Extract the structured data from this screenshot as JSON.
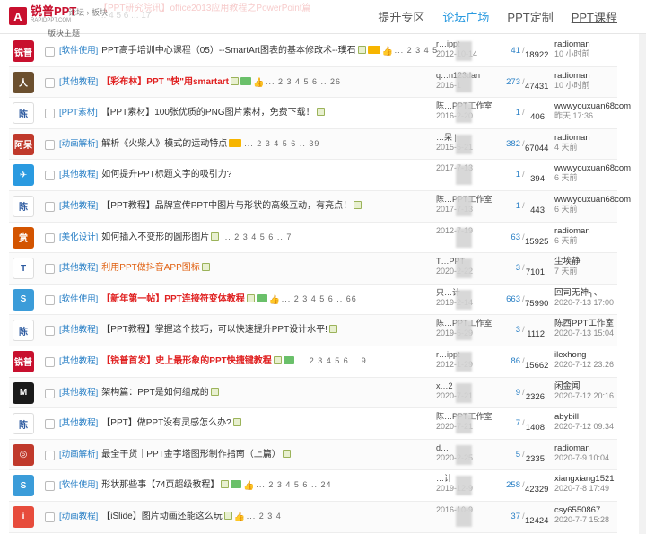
{
  "header": {
    "logo_mark": "A",
    "logo_text": "锐普PPT",
    "logo_sub": "RAPIDPPT.COM",
    "breadcrumb": "论坛 › 板块",
    "ghost_line1": "【PPT研究院讯】office2013应用教程之PowerPoint篇",
    "ghost_line2": "... 4 5 6 ... 17",
    "subtitle": "版块主题",
    "nav": [
      "提升专区",
      "论坛广场",
      "PPT定制",
      "PPT课程"
    ]
  },
  "threads": [
    {
      "cat": "[软件使用]",
      "title": "PPT高手培训中心课程（05）--SmartArt图表的基本修改术--璞石",
      "style": "",
      "pages": "2 3 4 5",
      "icons": [
        "img",
        "hot",
        "thumb"
      ],
      "author": "r…ippt",
      "date": "2012-10-14",
      "replies": "41",
      "views": "18922",
      "last_user": "radioman",
      "last_time": "10 小时前",
      "avatar_color": "#c8102e",
      "avatar_text": "锐普"
    },
    {
      "cat": "[其他教程]",
      "title": "【彩布林】PPT \"快\"用smartart",
      "style": "red",
      "pages": "2 3 4 5 6 .. 26",
      "icons": [
        "img",
        "new",
        "thumb"
      ],
      "author": "q…n123dan",
      "date": "2016-1",
      "replies": "273",
      "views": "47431",
      "last_user": "radioman",
      "last_time": "10 小时前",
      "avatar_color": "#6b4f2e",
      "avatar_text": "人"
    },
    {
      "cat": "[PPT素材]",
      "title": "【PPT素材】100张优质的PNG图片素材，免费下载！",
      "style": "",
      "pages": "",
      "icons": [
        "img"
      ],
      "author": "陈…PPT工作室",
      "date": "2016-2-20",
      "replies": "1",
      "views": "406",
      "last_user": "wwwyouxuan68com",
      "last_time": "昨天 17:36",
      "avatar_color": "#ffffff",
      "avatar_text": "陈"
    },
    {
      "cat": "[动画解析]",
      "title": "解析《火柴人》模式的运动特点",
      "style": "",
      "pages": "2 3 4 5 6 .. 39",
      "icons": [
        "hot"
      ],
      "author": "…呆 |",
      "date": "2015-5-21",
      "replies": "382",
      "views": "67044",
      "last_user": "radioman",
      "last_time": "4 天前",
      "avatar_color": "#c0392b",
      "avatar_text": "阿呆"
    },
    {
      "cat": "[其他教程]",
      "title": "如何提升PPT标题文字的吸引力?",
      "style": "",
      "pages": "",
      "icons": [],
      "author": "",
      "date": "2017-7-13",
      "replies": "1",
      "views": "394",
      "last_user": "wwwyouxuan68com",
      "last_time": "6 天前",
      "avatar_color": "#2a9ae0",
      "avatar_text": "✈"
    },
    {
      "cat": "[其他教程]",
      "title": "【PPT教程】品牌宣传PPT中图片与形状的高级互动，有亮点！",
      "style": "",
      "pages": "",
      "icons": [
        "img"
      ],
      "author": "陈…PPT工作室",
      "date": "2017-7-13",
      "replies": "1",
      "views": "443",
      "last_user": "wwwyouxuan68com",
      "last_time": "6 天前",
      "avatar_color": "#ffffff",
      "avatar_text": "陈"
    },
    {
      "cat": "[美化设计]",
      "title": "如何插入不变形的圆形图片",
      "style": "",
      "pages": "2 3 4 5 6 .. 7",
      "icons": [
        "img"
      ],
      "author": "",
      "date": "2012-7-19",
      "replies": "63",
      "views": "15925",
      "last_user": "radioman",
      "last_time": "6 天前",
      "avatar_color": "#d35400",
      "avatar_text": "赏"
    },
    {
      "cat": "[其他教程]",
      "title": "利用PPT做抖音APP图标",
      "style": "orange",
      "pages": "",
      "icons": [
        "img"
      ],
      "author": "T…PPT",
      "date": "2020-2-22",
      "replies": "3",
      "views": "7101",
      "last_user": "尘埃静",
      "last_time": "7 天前",
      "avatar_color": "#ffffff",
      "avatar_text": "T"
    },
    {
      "cat": "[软件使用]",
      "title": "【新年第一帖】PPT连接符变体教程",
      "style": "red",
      "pages": "2 3 4 5 6 .. 66",
      "icons": [
        "img",
        "new",
        "thumb"
      ],
      "author": "只…计",
      "date": "2019-2-14",
      "replies": "663",
      "views": "75990",
      "last_user": "回司无神╮、",
      "last_time": "2020-7-13 17:00",
      "avatar_color": "#3b9cd9",
      "avatar_text": "S"
    },
    {
      "cat": "[其他教程]",
      "title": "【PPT教程】掌握这个技巧，可以快速提升PPT设计水平!",
      "style": "",
      "pages": "",
      "icons": [
        "img"
      ],
      "author": "陈…PPT工作室",
      "date": "2019-5-29",
      "replies": "3",
      "views": "1112",
      "last_user": "陈西PPT工作室",
      "last_time": "2020-7-13 15:04",
      "avatar_color": "#ffffff",
      "avatar_text": "陈"
    },
    {
      "cat": "[其他教程]",
      "title": "【锐普首发】史上最形象的PPT快捷键教程",
      "style": "red",
      "pages": "2 3 4 5 6 .. 9",
      "icons": [
        "img",
        "new"
      ],
      "author": "r…ippt",
      "date": "2012-1-29",
      "replies": "86",
      "views": "15662",
      "last_user": "ilexhong",
      "last_time": "2020-7-12 23:26",
      "avatar_color": "#c8102e",
      "avatar_text": "锐普"
    },
    {
      "cat": "[其他教程]",
      "title": "架构篇：PPT是如何组成的",
      "style": "",
      "pages": "",
      "icons": [
        "img"
      ],
      "author": "x…2",
      "date": "2020-7-21",
      "replies": "9",
      "views": "2326",
      "last_user": "闲金闻",
      "last_time": "2020-7-12 20:16",
      "avatar_color": "#1a1a1a",
      "avatar_text": "M"
    },
    {
      "cat": "[其他教程]",
      "title": "【PPT】做PPT没有灵感怎么办?",
      "style": "",
      "pages": "",
      "icons": [
        "img"
      ],
      "author": "陈…PPT工作室",
      "date": "2020-7-21",
      "replies": "7",
      "views": "1408",
      "last_user": "abybill",
      "last_time": "2020-7-12 09:34",
      "avatar_color": "#ffffff",
      "avatar_text": "陈"
    },
    {
      "cat": "[动画解析]",
      "title": "最全干货｜PPT金字塔图形制作指南（上篇）",
      "style": "",
      "pages": "",
      "icons": [
        "img"
      ],
      "author": "d…",
      "date": "2020-2-25",
      "replies": "5",
      "views": "2335",
      "last_user": "radioman",
      "last_time": "2020-7-9 10:04",
      "avatar_color": "#c0392b",
      "avatar_text": "◎"
    },
    {
      "cat": "[软件使用]",
      "title": "形状那些事【74页超级教程】",
      "style": "",
      "pages": "2 3 4 5 6 .. 24",
      "icons": [
        "img",
        "new",
        "thumb"
      ],
      "author": "…计",
      "date": "2019-12-9",
      "replies": "258",
      "views": "42329",
      "last_user": "xiangxiang1521",
      "last_time": "2020-7-8 17:49",
      "avatar_color": "#3b9cd9",
      "avatar_text": "S"
    },
    {
      "cat": "[动画教程]",
      "title": "【iSlide】图片动画还能这么玩",
      "style": "",
      "pages": "2 3 4",
      "icons": [
        "img",
        "thumb"
      ],
      "author": "",
      "date": "2016-10-9",
      "replies": "37",
      "views": "12424",
      "last_user": "csy6550867",
      "last_time": "2020-7-7 15:28",
      "avatar_color": "#e74c3c",
      "avatar_text": "i"
    }
  ]
}
